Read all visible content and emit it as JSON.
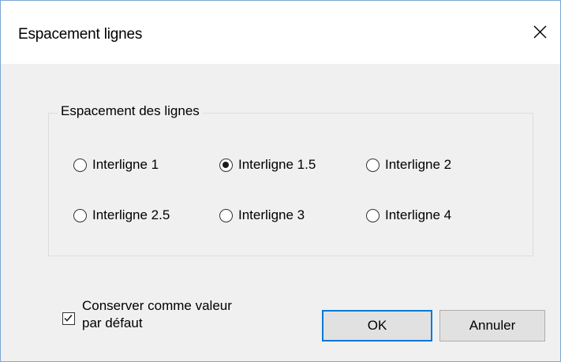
{
  "window": {
    "title": "Espacement lignes",
    "close_icon": "close-icon"
  },
  "group": {
    "legend": "Espacement des lignes",
    "options": [
      {
        "label": "Interligne 1",
        "checked": false
      },
      {
        "label": "Interligne 1.5",
        "checked": true
      },
      {
        "label": "Interligne 2",
        "checked": false
      },
      {
        "label": "Interligne 2.5",
        "checked": false
      },
      {
        "label": "Interligne 3",
        "checked": false
      },
      {
        "label": "Interligne 4",
        "checked": false
      }
    ]
  },
  "default_checkbox": {
    "label": "Conserver comme valeur par défaut",
    "checked": true
  },
  "buttons": {
    "ok_label": "OK",
    "cancel_label": "Annuler"
  },
  "colors": {
    "window_border": "#7aa8d6",
    "dialog_bg": "#f0f0f0",
    "default_button_border": "#0078d7"
  }
}
